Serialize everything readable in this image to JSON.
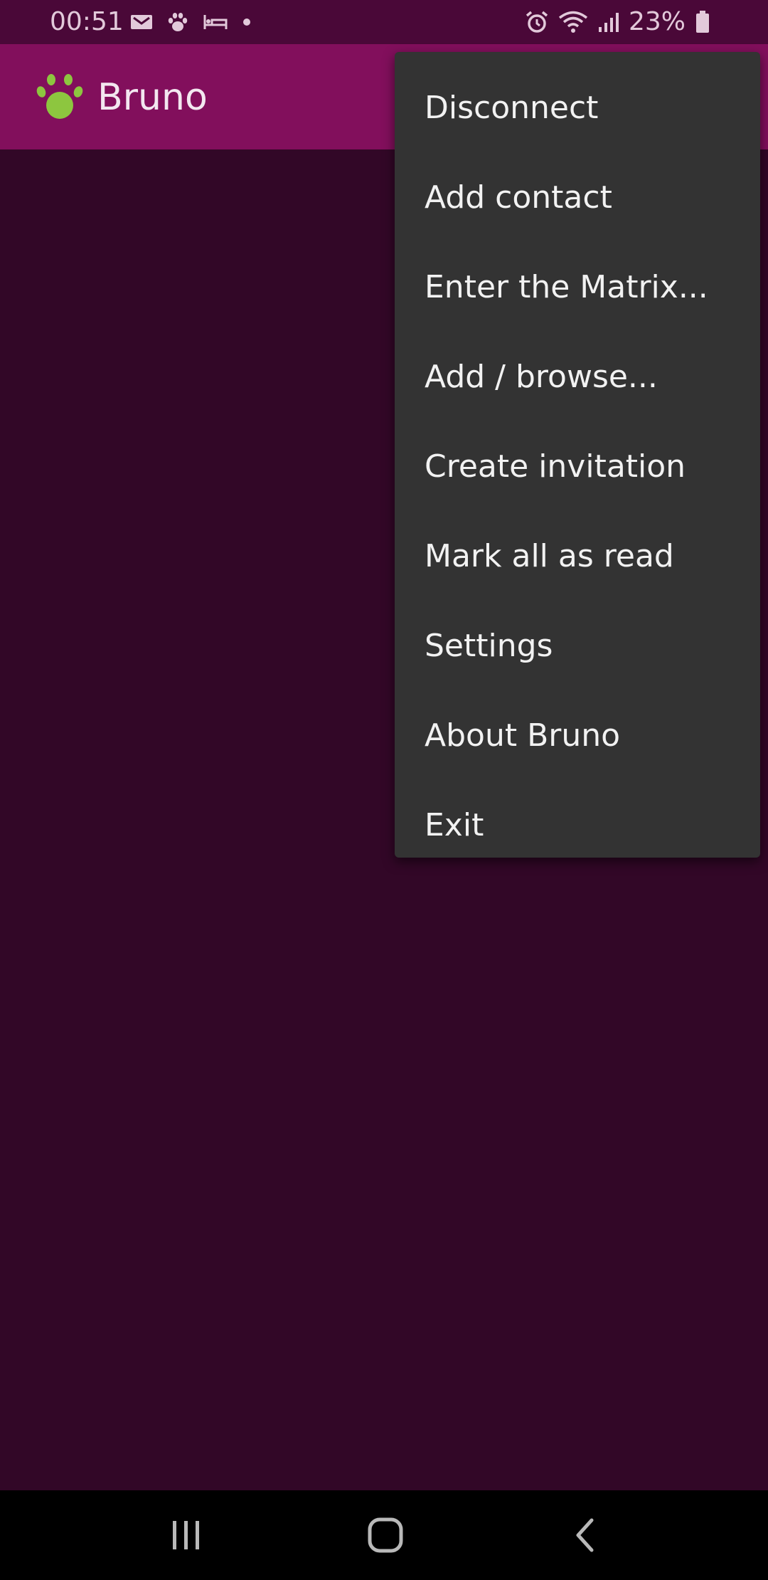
{
  "status_bar": {
    "time": "00:51",
    "battery": "23%",
    "left_icons": [
      "message-icon",
      "paw-icon",
      "bed-icon",
      "dot-icon"
    ],
    "right_icons": [
      "alarm-icon",
      "wifi-icon",
      "signal-icon",
      "battery-icon"
    ]
  },
  "app_bar": {
    "title": "Bruno",
    "logo_icon": "paw-logo-icon",
    "logo_color": "#8dc63f",
    "background": "#820f5c"
  },
  "menu": {
    "items": [
      {
        "label": "Disconnect"
      },
      {
        "label": "Add contact"
      },
      {
        "label": "Enter the Matrix..."
      },
      {
        "label": "Add / browse..."
      },
      {
        "label": "Create invitation"
      },
      {
        "label": "Mark all as read"
      },
      {
        "label": "Settings"
      },
      {
        "label": "About Bruno"
      },
      {
        "label": "Exit"
      }
    ]
  },
  "nav_bar": {
    "buttons": [
      "recents-icon",
      "home-icon",
      "back-icon"
    ]
  },
  "colors": {
    "status_bar": "#4a0838",
    "main_background": "#320727",
    "menu_background": "#333333",
    "nav_bar": "#000000"
  }
}
